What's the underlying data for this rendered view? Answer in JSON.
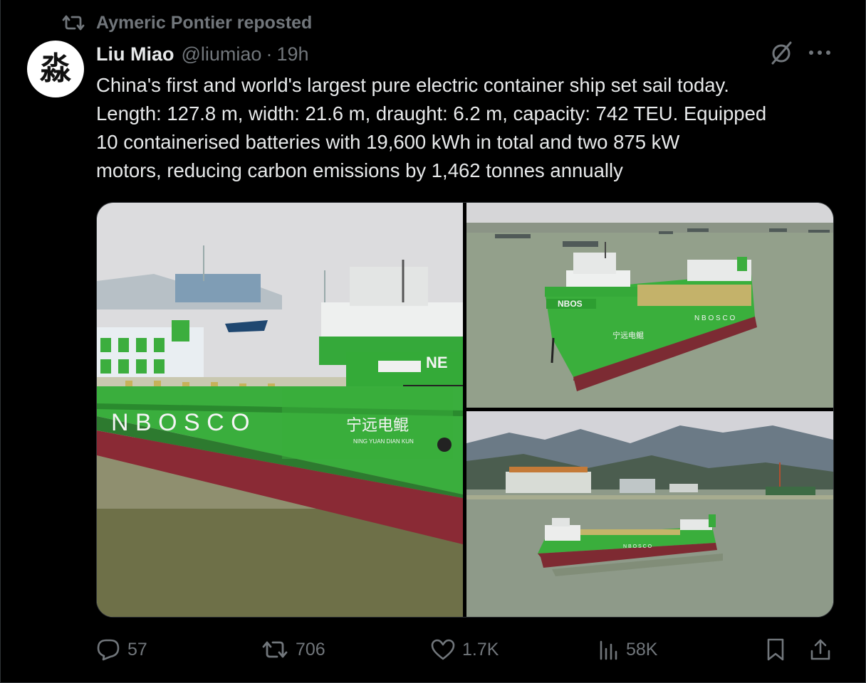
{
  "repost": {
    "text": "Aymeric Pontier reposted",
    "icon": "repost-icon"
  },
  "author": {
    "avatar_glyph": "淼",
    "name": "Liu Miao",
    "handle": "@liumiao",
    "separator": "·",
    "time": "19h"
  },
  "tweet": {
    "lines": [
      "China's first and world's largest pure electric container ship set sail today.",
      "Length: 127.8 m, width: 21.6 m, draught: 6.2 m, capacity: 742 TEU. Equipped",
      "10 containerised batteries with 19,600 kWh in total and two 875 kW",
      "motors, reducing carbon emissions by 1,462 tonnes annually"
    ]
  },
  "media": {
    "hull_markings": {
      "side_lettering": "N B O S C O",
      "bow_lettering": "NBOS",
      "main_partial": "NE",
      "chinese_name": "宁远电鲲",
      "pinyin": "NING YUAN DIAN KUN"
    },
    "colors": {
      "hull_green": "#39b23c",
      "hull_red": "#8a2a35",
      "water": "#8f9a86",
      "sky": "#d8d8da"
    }
  },
  "actions": {
    "reply_count": "57",
    "repost_count": "706",
    "like_count": "1.7K",
    "views_count": "58K"
  },
  "theme": {
    "background": "#000000",
    "text": "#e7e9ea",
    "muted": "#71767b",
    "border": "#2f3336"
  }
}
